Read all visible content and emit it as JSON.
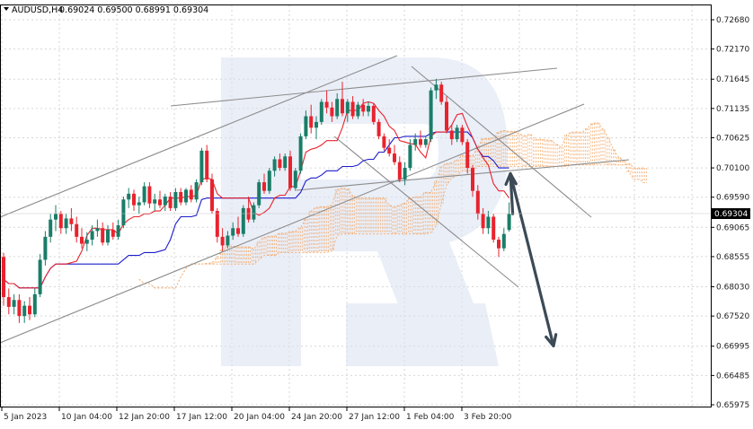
{
  "header": {
    "symbol_label": "AUDUSD,H4",
    "ohlc": "0.69024 0.69500 0.68991 0.69304"
  },
  "icons": {
    "menu": "triangle-down-icon"
  },
  "colors": {
    "bull_candle": "#1a7d68",
    "bear_candle": "#e8232e",
    "tenkan_sen": "#e8232e",
    "kijun_sen": "#1c1ccc",
    "kumo": "#f4a460",
    "trendlines": "#8c8c8c",
    "forecast_arrows": "#3b4a56",
    "watermark": "#d9e1f2",
    "price_tag_bg": "#000000",
    "price_tag_text": "#ffffff"
  },
  "chart_data": {
    "type": "candlestick",
    "symbol": "AUDUSD",
    "timeframe": "H4",
    "indicator": "Ichimoku Kinko Hyo",
    "current_price": "0.69304",
    "ylim": [
      0.65975,
      0.7268
    ],
    "y_ticks": [
      "0.72680",
      "0.72170",
      "0.71645",
      "0.71135",
      "0.70625",
      "0.70100",
      "0.69590",
      "0.69065",
      "0.68555",
      "0.68030",
      "0.67520",
      "0.66995",
      "0.66485",
      "0.65975"
    ],
    "x_ticks": [
      "5 Jan 2023",
      "10 Jan 04:00",
      "12 Jan 20:00",
      "17 Jan 12:00",
      "20 Jan 04:00",
      "24 Jan 20:00",
      "27 Jan 12:00",
      "1 Feb 04:00",
      "3 Feb 20:00"
    ],
    "candles": [
      [
        0.6855,
        0.6862,
        0.677,
        0.6785
      ],
      [
        0.6785,
        0.68,
        0.6755,
        0.6768
      ],
      [
        0.6768,
        0.679,
        0.6755,
        0.678
      ],
      [
        0.678,
        0.679,
        0.674,
        0.6752
      ],
      [
        0.6752,
        0.6778,
        0.674,
        0.677
      ],
      [
        0.677,
        0.6785,
        0.6745,
        0.6755
      ],
      [
        0.6755,
        0.68,
        0.675,
        0.679
      ],
      [
        0.679,
        0.686,
        0.6785,
        0.685
      ],
      [
        0.685,
        0.69,
        0.684,
        0.689
      ],
      [
        0.689,
        0.693,
        0.688,
        0.692
      ],
      [
        0.692,
        0.6945,
        0.69,
        0.693
      ],
      [
        0.693,
        0.6935,
        0.6895,
        0.6905
      ],
      [
        0.6905,
        0.693,
        0.6895,
        0.6922
      ],
      [
        0.6922,
        0.694,
        0.69,
        0.6912
      ],
      [
        0.6912,
        0.6925,
        0.688,
        0.689
      ],
      [
        0.689,
        0.6905,
        0.687,
        0.6878
      ],
      [
        0.6878,
        0.6898,
        0.6865,
        0.6885
      ],
      [
        0.6885,
        0.691,
        0.6875,
        0.69
      ],
      [
        0.69,
        0.692,
        0.689,
        0.6905
      ],
      [
        0.6905,
        0.6915,
        0.6875,
        0.688
      ],
      [
        0.688,
        0.691,
        0.6875,
        0.6902
      ],
      [
        0.6902,
        0.6915,
        0.6885,
        0.689
      ],
      [
        0.689,
        0.692,
        0.6885,
        0.691
      ],
      [
        0.691,
        0.696,
        0.6905,
        0.6955
      ],
      [
        0.6955,
        0.6975,
        0.694,
        0.6965
      ],
      [
        0.6965,
        0.6972,
        0.6935,
        0.6945
      ],
      [
        0.6945,
        0.696,
        0.693,
        0.695
      ],
      [
        0.695,
        0.6985,
        0.6945,
        0.6978
      ],
      [
        0.6978,
        0.6985,
        0.694,
        0.6948
      ],
      [
        0.6948,
        0.6965,
        0.6935,
        0.6955
      ],
      [
        0.6955,
        0.697,
        0.694,
        0.6945
      ],
      [
        0.6945,
        0.6965,
        0.6935,
        0.696
      ],
      [
        0.696,
        0.6968,
        0.6935,
        0.694
      ],
      [
        0.694,
        0.6975,
        0.6935,
        0.6968
      ],
      [
        0.6968,
        0.6975,
        0.6945,
        0.695
      ],
      [
        0.695,
        0.6975,
        0.6945,
        0.6972
      ],
      [
        0.6972,
        0.698,
        0.695,
        0.6955
      ],
      [
        0.6955,
        0.699,
        0.695,
        0.6985
      ],
      [
        0.6985,
        0.7045,
        0.698,
        0.704
      ],
      [
        0.704,
        0.705,
        0.6985,
        0.699
      ],
      [
        0.699,
        0.7,
        0.693,
        0.6935
      ],
      [
        0.6935,
        0.694,
        0.688,
        0.689
      ],
      [
        0.689,
        0.6905,
        0.6865,
        0.6875
      ],
      [
        0.6875,
        0.69,
        0.687,
        0.6892
      ],
      [
        0.6892,
        0.6915,
        0.6885,
        0.6905
      ],
      [
        0.6905,
        0.6925,
        0.689,
        0.6895
      ],
      [
        0.6895,
        0.6945,
        0.689,
        0.694
      ],
      [
        0.694,
        0.696,
        0.6915,
        0.692
      ],
      [
        0.692,
        0.695,
        0.6915,
        0.6945
      ],
      [
        0.6945,
        0.699,
        0.694,
        0.6985
      ],
      [
        0.6985,
        0.7,
        0.6965,
        0.697
      ],
      [
        0.697,
        0.701,
        0.6965,
        0.7005
      ],
      [
        0.7005,
        0.703,
        0.6995,
        0.7025
      ],
      [
        0.7025,
        0.7035,
        0.7005,
        0.701
      ],
      [
        0.701,
        0.7035,
        0.7005,
        0.703
      ],
      [
        0.703,
        0.704,
        0.697,
        0.6975
      ],
      [
        0.6975,
        0.701,
        0.697,
        0.7005
      ],
      [
        0.7005,
        0.707,
        0.7,
        0.7065
      ],
      [
        0.7065,
        0.711,
        0.706,
        0.71
      ],
      [
        0.71,
        0.712,
        0.707,
        0.708
      ],
      [
        0.708,
        0.71,
        0.706,
        0.709
      ],
      [
        0.709,
        0.713,
        0.7085,
        0.7125
      ],
      [
        0.7125,
        0.7145,
        0.7105,
        0.7115
      ],
      [
        0.7115,
        0.7125,
        0.709,
        0.71
      ],
      [
        0.71,
        0.714,
        0.7095,
        0.713
      ],
      [
        0.713,
        0.716,
        0.71,
        0.7105
      ],
      [
        0.7105,
        0.713,
        0.709,
        0.7125
      ],
      [
        0.7125,
        0.7135,
        0.7095,
        0.71
      ],
      [
        0.71,
        0.7125,
        0.7095,
        0.712
      ],
      [
        0.712,
        0.713,
        0.71,
        0.7108
      ],
      [
        0.7108,
        0.7125,
        0.71,
        0.7118
      ],
      [
        0.7118,
        0.7122,
        0.7085,
        0.709
      ],
      [
        0.709,
        0.7095,
        0.706,
        0.7065
      ],
      [
        0.7065,
        0.707,
        0.704,
        0.7045
      ],
      [
        0.7045,
        0.706,
        0.703,
        0.7035
      ],
      [
        0.7035,
        0.705,
        0.7015,
        0.702
      ],
      [
        0.702,
        0.703,
        0.6985,
        0.699
      ],
      [
        0.699,
        0.702,
        0.698,
        0.701
      ],
      [
        0.701,
        0.706,
        0.7005,
        0.705
      ],
      [
        0.705,
        0.707,
        0.704,
        0.706
      ],
      [
        0.706,
        0.7075,
        0.7045,
        0.705
      ],
      [
        0.705,
        0.7065,
        0.7045,
        0.706
      ],
      [
        0.706,
        0.715,
        0.7055,
        0.7145
      ],
      [
        0.7145,
        0.7165,
        0.713,
        0.7155
      ],
      [
        0.7155,
        0.716,
        0.712,
        0.7125
      ],
      [
        0.7125,
        0.7135,
        0.707,
        0.7075
      ],
      [
        0.7075,
        0.7085,
        0.705,
        0.706
      ],
      [
        0.706,
        0.7085,
        0.7055,
        0.708
      ],
      [
        0.708,
        0.7085,
        0.705,
        0.7055
      ],
      [
        0.7055,
        0.706,
        0.7,
        0.701
      ],
      [
        0.701,
        0.7015,
        0.696,
        0.697
      ],
      [
        0.697,
        0.698,
        0.692,
        0.693
      ],
      [
        0.693,
        0.694,
        0.6895,
        0.6905
      ],
      [
        0.6905,
        0.6935,
        0.6895,
        0.6925
      ],
      [
        0.6925,
        0.693,
        0.688,
        0.6885
      ],
      [
        0.6885,
        0.689,
        0.6855,
        0.687
      ],
      [
        0.687,
        0.6905,
        0.6865,
        0.6895
      ],
      [
        0.6902,
        0.695,
        0.6899,
        0.693
      ]
    ],
    "forecast_path": [
      [
        "3 Feb 20:00",
        0.693
      ],
      [
        "",
        0.7
      ],
      [
        "",
        0.67
      ]
    ]
  }
}
